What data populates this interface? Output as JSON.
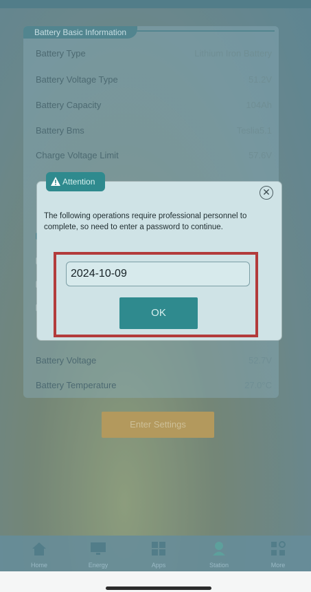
{
  "info": {
    "section_title": "Battery Basic Information",
    "rows": [
      {
        "label": "Battery Type",
        "value": "Lithium Iron Battery"
      },
      {
        "label": "Battery Voltage Type",
        "value": "51.2V"
      },
      {
        "label": "Battery Capacity",
        "value": "104Ah"
      },
      {
        "label": "Battery Bms",
        "value": "Teslia5.1"
      },
      {
        "label": "Charge Voltage Limit",
        "value": "57.6V"
      }
    ],
    "lower_rows": [
      {
        "label": "Battery Voltage",
        "value": "52.7V"
      },
      {
        "label": "Battery Temperature",
        "value": "27.0°C"
      }
    ],
    "action_button": "Enter Settings"
  },
  "dialog": {
    "tab_label": "Attention",
    "message": "The following operations require professional personnel to complete, so need to enter a password to continue.",
    "password_value": "2024-10-09",
    "ok_label": "OK"
  },
  "nav": [
    {
      "label": "Home",
      "icon": "home-icon"
    },
    {
      "label": "Energy",
      "icon": "monitor-icon"
    },
    {
      "label": "Apps",
      "icon": "grid-icon"
    },
    {
      "label": "Station",
      "icon": "station-icon"
    },
    {
      "label": "More",
      "icon": "more-icon"
    }
  ]
}
